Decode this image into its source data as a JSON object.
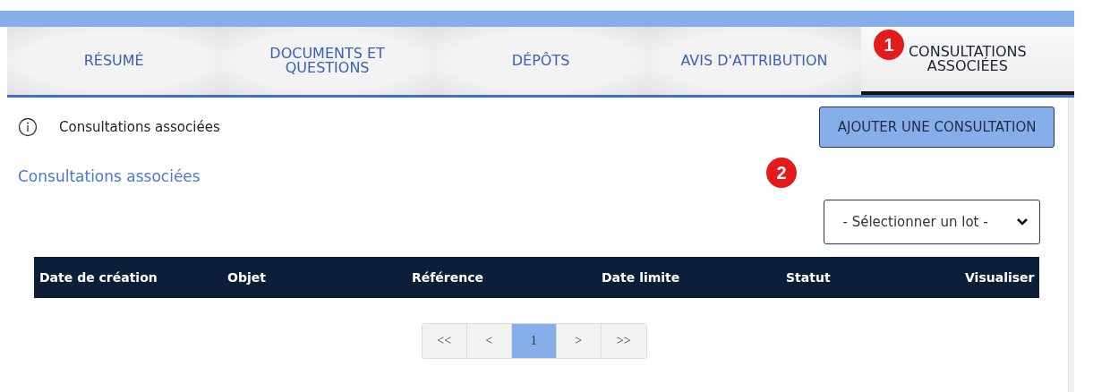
{
  "tabs": [
    {
      "label": "RÉSUMÉ",
      "selected": false
    },
    {
      "label": "DOCUMENTS ET QUESTIONS",
      "selected": false
    },
    {
      "label": "DÉPÔTS",
      "selected": false
    },
    {
      "label": "AVIS D'ATTRIBUTION",
      "selected": false
    },
    {
      "label": "CONSULTATIONS ASSOCIÉES",
      "selected": true
    }
  ],
  "callouts": [
    "1",
    "2"
  ],
  "info": {
    "text": "Consultations associées"
  },
  "add_button": "AJOUTER UNE CONSULTATION",
  "section_title": "Consultations associées",
  "lot_select": {
    "value": "- Sélectionner un lot -"
  },
  "table": {
    "columns": [
      "Date de création",
      "Objet",
      "Référence",
      "Date limite",
      "Statut",
      "Visualiser"
    ]
  },
  "pagination": [
    {
      "label": "<<",
      "selected": false
    },
    {
      "label": "<",
      "selected": false
    },
    {
      "label": "1",
      "selected": true
    },
    {
      "label": ">",
      "selected": false
    },
    {
      "label": ">>",
      "selected": false
    }
  ]
}
